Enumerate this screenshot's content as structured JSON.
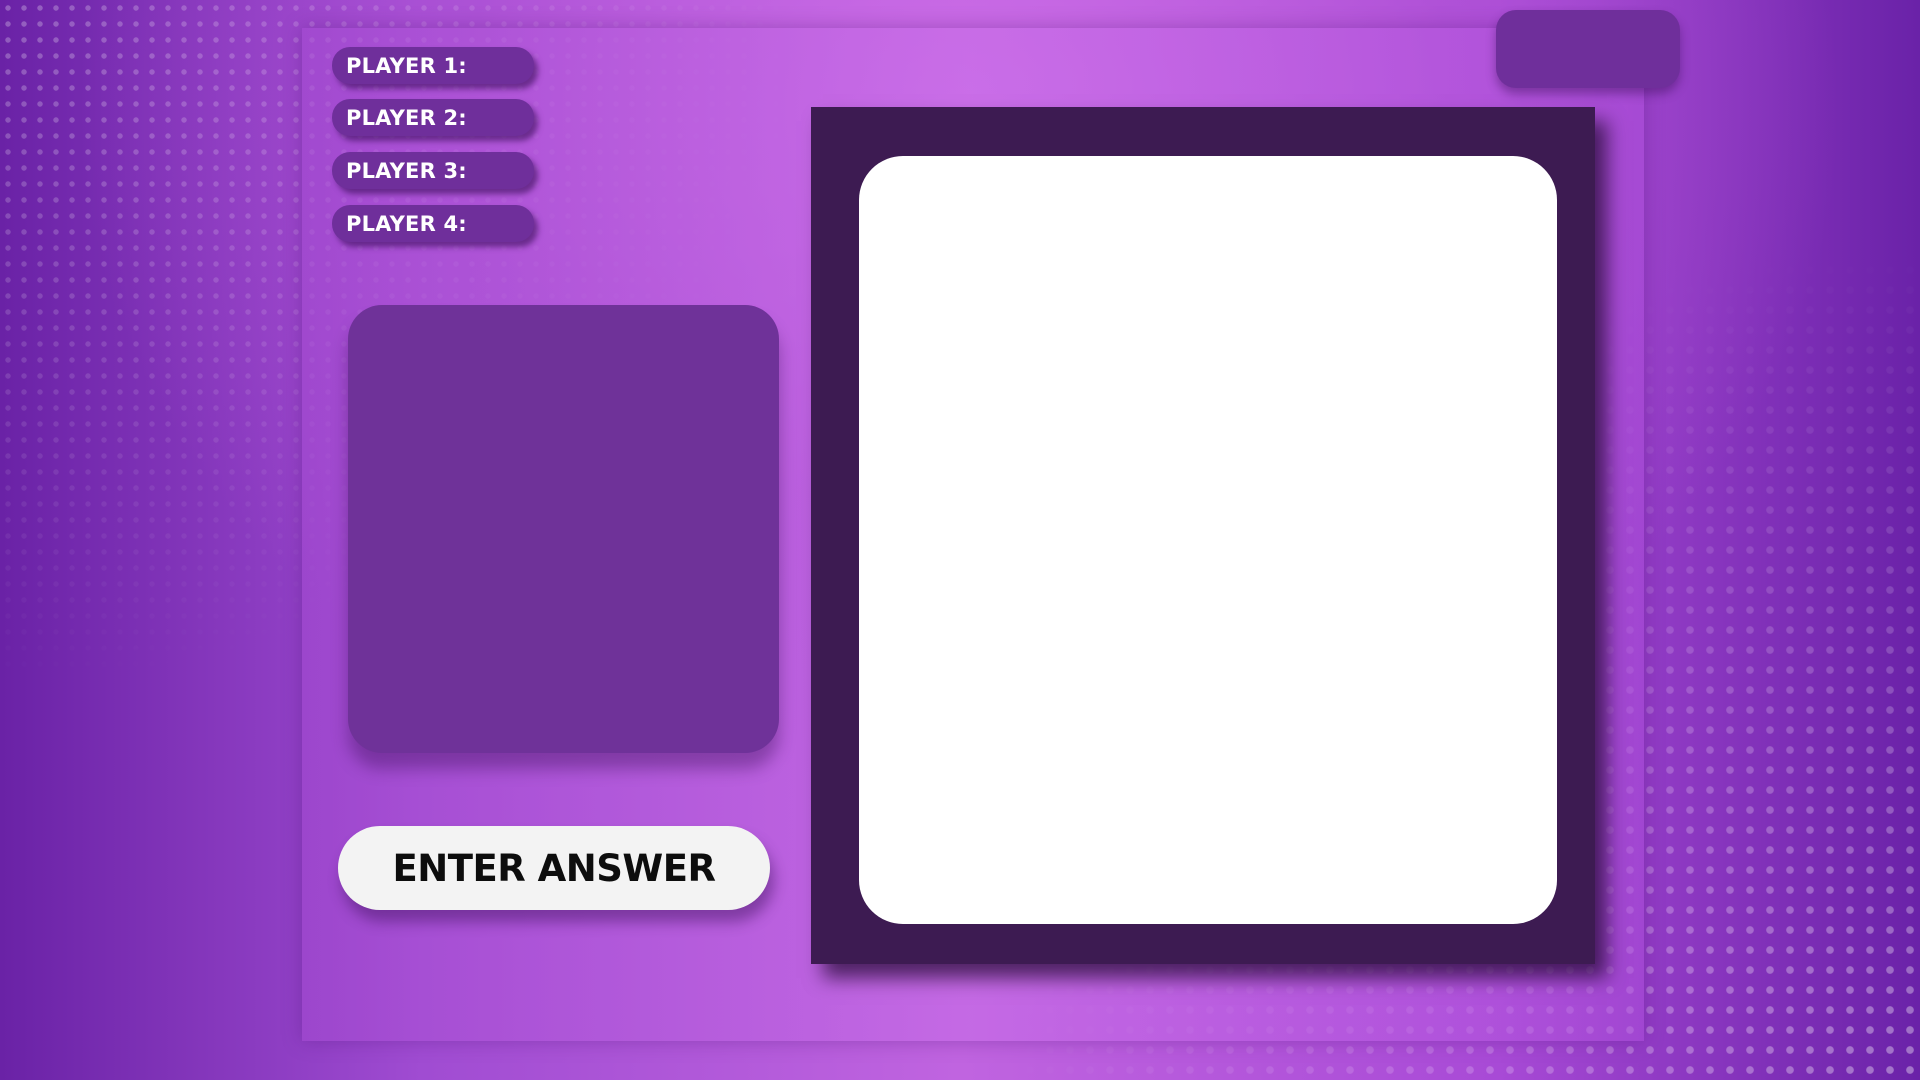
{
  "players": [
    {
      "label": "PLAYER 1:"
    },
    {
      "label": "PLAYER 2:"
    },
    {
      "label": "PLAYER 3:"
    },
    {
      "label": "PLAYER 4:"
    }
  ],
  "answer_button": {
    "label": "ENTER ANSWER"
  },
  "colors": {
    "accent_purple": "#6f2f9b",
    "board_frame": "#3d1b52",
    "board_screen": "#ffffff",
    "button_bg": "#f3f3f3"
  }
}
